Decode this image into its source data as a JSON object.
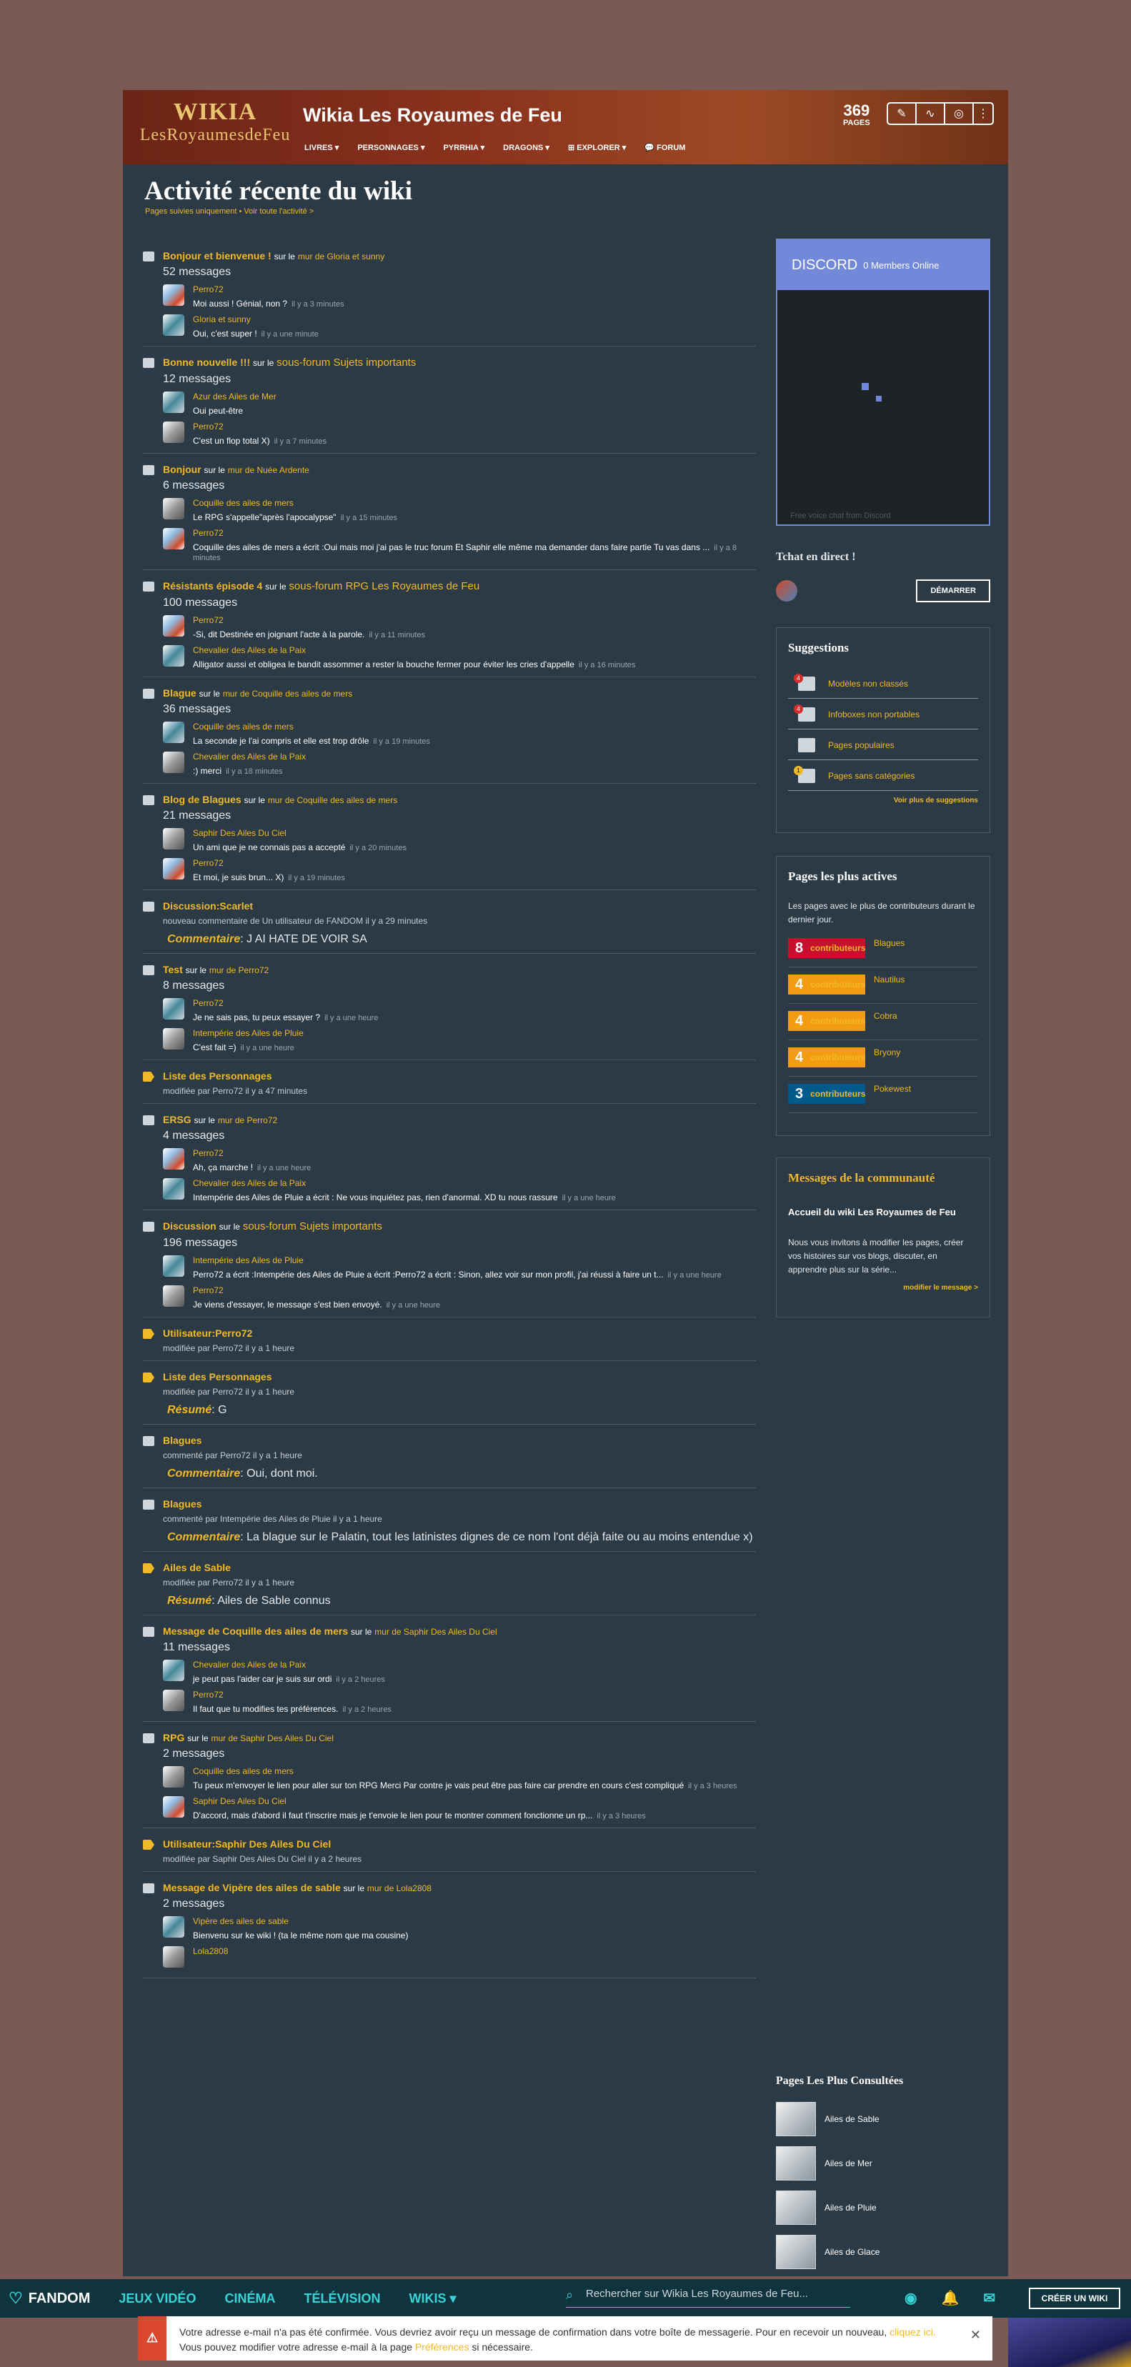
{
  "header": {
    "logo_top": "WIKIA",
    "logo_bottom": "LesRoyaumesdeFeu",
    "title": "Wikia Les Royaumes de Feu",
    "pages_count": "369",
    "pages_label": "PAGES",
    "nav": [
      "LIVRES ▾",
      "PERSONNAGES ▾",
      "PYRRHIA ▾",
      "DRAGONS ▾",
      "⊞ EXPLORER ▾",
      "💬 FORUM"
    ]
  },
  "page": {
    "title": "Activité récente du wiki",
    "subnav": "Pages suivies uniquement • Voir toute l'activité >"
  },
  "feed": [
    {
      "title": "Bonjour et bienvenue !",
      "on": "sur le",
      "where": "mur de Gloria et sunny",
      "count": "52 messages",
      "msgs": [
        {
          "user": "Perro72",
          "text": "Moi aussi ! Génial, non ?",
          "time": "il y a 3 minutes"
        },
        {
          "user": "Gloria et sunny",
          "text": "Oui, c'est super !",
          "time": "il y a une minute"
        }
      ]
    },
    {
      "title": "Bonne nouvelle !!!",
      "on": "sur le",
      "where": "sous-forum Sujets importants",
      "count": "12 messages",
      "msgs": [
        {
          "user": "Azur des Ailes de Mer",
          "text": "Oui peut-être",
          "time": ""
        },
        {
          "user": "Perro72",
          "text": "C'est un flop total X)",
          "time": "il y a 7 minutes"
        }
      ]
    },
    {
      "title": "Bonjour",
      "on": "sur le",
      "where": "mur de Nuée Ardente",
      "count": "6 messages",
      "msgs": [
        {
          "user": "Coquille des ailes de mers",
          "text": "Le RPG s'appelle\"après l'apocalypse\"",
          "time": "il y a 15 minutes"
        },
        {
          "user": "Perro72",
          "text": "Coquille des ailes de mers a écrit :Oui mais moi j'ai pas le truc forum Et Saphir elle même ma demander dans faire partie Tu vas dans ...",
          "time": "il y a 8 minutes"
        }
      ]
    },
    {
      "title": "Résistants épisode 4",
      "on": "sur le",
      "where": "sous-forum RPG Les Royaumes de Feu",
      "count": "100 messages",
      "msgs": [
        {
          "user": "Perro72",
          "text": "-Si, dit Destinée en joignant l'acte à la parole.",
          "time": "il y a 11 minutes"
        },
        {
          "user": "Chevalier des Ailes de la Paix",
          "text": "Alligator aussi et obligea le bandit assommer a rester la bouche fermer pour éviter les cries d'appelle",
          "time": "il y a 16 minutes"
        }
      ]
    },
    {
      "title": "Blague",
      "on": "sur le",
      "where": "mur de Coquille des ailes de mers",
      "count": "36 messages",
      "msgs": [
        {
          "user": "Coquille des ailes de mers",
          "text": "La seconde je l'ai compris et elle est trop drôle",
          "time": "il y a 19 minutes"
        },
        {
          "user": "Chevalier des Ailes de la Paix",
          "text": ":) merci",
          "time": "il y a 18 minutes"
        }
      ]
    },
    {
      "title": "Blog de Blagues",
      "on": "sur le",
      "where": "mur de Coquille des ailes de mers",
      "count": "21 messages",
      "msgs": [
        {
          "user": "Saphir Des Ailes Du Ciel",
          "text": "Un ami que je ne connais pas a accepté",
          "time": "il y a 20 minutes"
        },
        {
          "user": "Perro72",
          "text": "Et moi, je suis brun... X)",
          "time": "il y a 19 minutes"
        }
      ]
    },
    {
      "title": "Discussion:Scarlet",
      "meta": "nouveau commentaire de Un utilisateur de FANDOM il y a 29 minutes",
      "comment_label": "Commentaire",
      "comment": ": J AI HATE DE VOIR SA"
    },
    {
      "title": "Test",
      "on": "sur le",
      "where": "mur de Perro72",
      "count": "8 messages",
      "msgs": [
        {
          "user": "Perro72",
          "text": "Je ne sais pas, tu peux essayer ?",
          "time": "il y a une heure"
        },
        {
          "user": "Intempérie des Ailes de Pluie",
          "text": "C'est fait =)",
          "time": "il y a une heure"
        }
      ]
    },
    {
      "title": "Liste des Personnages",
      "edit": true,
      "meta": "modifiée par Perro72 il y a 47 minutes"
    },
    {
      "title": "ERSG",
      "on": "sur le",
      "where": "mur de Perro72",
      "count": "4 messages",
      "msgs": [
        {
          "user": "Perro72",
          "text": "Ah, ça marche !",
          "time": "il y a une heure"
        },
        {
          "user": "Chevalier des Ailes de la Paix",
          "text": "Intempérie des Ailes de Pluie a écrit : Ne vous inquiétez pas, rien d'anormal. XD tu nous rassure",
          "time": "il y a une heure"
        }
      ]
    },
    {
      "title": "Discussion",
      "on": "sur le",
      "where": "sous-forum Sujets importants",
      "count": "196 messages",
      "msgs": [
        {
          "user": "Intempérie des Ailes de Pluie",
          "text": "Perro72 a écrit :Intempérie des Ailes de Pluie a écrit :Perro72 a écrit : Sinon, allez voir sur mon profil, j'ai réussi à faire un t...",
          "time": "il y a une heure"
        },
        {
          "user": "Perro72",
          "text": "Je viens d'essayer, le message s'est bien envoyé.",
          "time": "il y a une heure"
        }
      ]
    },
    {
      "title": "Utilisateur:Perro72",
      "edit": true,
      "meta": "modifiée par Perro72 il y a 1 heure"
    },
    {
      "title": "Liste des Personnages",
      "edit": true,
      "meta": "modifiée par Perro72 il y a 1 heure",
      "comment_label": "Résumé",
      "comment": ": G"
    },
    {
      "title": "Blagues",
      "meta": "commenté par Perro72 il y a 1 heure",
      "comment_label": "Commentaire",
      "comment": ": Oui, dont moi."
    },
    {
      "title": "Blagues",
      "meta": "commenté par Intempérie des Ailes de Pluie il y a 1 heure",
      "comment_label": "Commentaire",
      "comment": ": La blague sur le Palatin, tout les latinistes dignes de ce nom l'ont déjà faite ou au moins entendue x)"
    },
    {
      "title": "Ailes de Sable",
      "edit": true,
      "meta": "modifiée par Perro72 il y a 1 heure",
      "comment_label": "Résumé",
      "comment": ": Ailes de Sable connus"
    },
    {
      "title": "Message de Coquille des ailes de mers",
      "on": "sur le",
      "where": "mur de Saphir Des Ailes Du Ciel",
      "count": "11 messages",
      "msgs": [
        {
          "user": "Chevalier des Ailes de la Paix",
          "text": "je peut pas l'aider car je suis sur ordi",
          "time": "il y a 2 heures"
        },
        {
          "user": "Perro72",
          "text": "Il faut que tu modifies tes préférences.",
          "time": "il y a 2 heures"
        }
      ]
    },
    {
      "title": "RPG",
      "on": "sur le",
      "where": "mur de Saphir Des Ailes Du Ciel",
      "count": "2 messages",
      "msgs": [
        {
          "user": "Coquille des ailes de mers",
          "text": "Tu peux m'envoyer le lien pour aller sur ton RPG Merci Par contre je vais peut être pas faire car prendre en cours c'est compliqué",
          "time": "il y a 3 heures"
        },
        {
          "user": "Saphir Des Ailes Du Ciel",
          "text": "D'accord, mais d'abord il faut t'inscrire mais je t'envoie le lien pour te montrer comment fonctionne un rp...",
          "time": "il y a 3 heures"
        }
      ]
    },
    {
      "title": "Utilisateur:Saphir Des Ailes Du Ciel",
      "edit": true,
      "meta": "modifiée par Saphir Des Ailes Du Ciel il y a 2 heures"
    },
    {
      "title": "Message de Vipère des ailes de sable",
      "on": "sur le",
      "where": "mur de Lola2808",
      "count": "2 messages",
      "msgs": [
        {
          "user": "Vipère des ailes de sable",
          "text": "Bienvenu sur ke wiki ! (ta le même nom que ma cousine)",
          "time": ""
        },
        {
          "user": "Lola2808",
          "text": "",
          "time": ""
        }
      ]
    }
  ],
  "discord": {
    "title": "DISCORD",
    "members": "0 Members Online",
    "footer": "Free voice chat from Discord"
  },
  "tchat": {
    "title": "Tchat en direct !",
    "button": "DÉMARRER"
  },
  "suggestions": {
    "title": "Suggestions",
    "items": [
      {
        "badge": "4",
        "label": "Modèles non classés"
      },
      {
        "badge": "4",
        "label": "Infoboxes non portables"
      },
      {
        "badge": "",
        "label": "Pages populaires"
      },
      {
        "badge": "1",
        "label": "Pages sans catégories"
      }
    ],
    "more": "Voir plus de suggestions"
  },
  "active": {
    "title": "Pages les plus actives",
    "desc": "Les pages avec le plus de contributeurs durant le dernier jour.",
    "unit": "contributeurs",
    "items": [
      {
        "n": "8",
        "page": "Blagues"
      },
      {
        "n": "4",
        "page": "Nautilus"
      },
      {
        "n": "4",
        "page": "Cobra"
      },
      {
        "n": "4",
        "page": "Bryony"
      },
      {
        "n": "3",
        "page": "Pokewest"
      }
    ]
  },
  "community": {
    "title": "Messages de la communauté",
    "heading": "Accueil du wiki Les Royaumes de Feu",
    "text": "Nous vous invitons à modifier les pages, créer vos histoires sur vos blogs, discuter, en apprendre plus sur la série...",
    "more": "modifier le message >"
  },
  "popular": {
    "title": "Pages Les Plus Consultées",
    "items": [
      "Ailes de Sable",
      "Ailes de Mer",
      "Ailes de Pluie",
      "Ailes de Glace"
    ]
  },
  "globalnav": {
    "brand": "FANDOM",
    "items": [
      "JEUX VIDÉO",
      "CINÉMA",
      "TÉLÉVISION",
      "WIKIS ▾"
    ],
    "search_placeholder": "Rechercher sur Wikia Les Royaumes de Feu...",
    "create": "CRÉER UN WIKI"
  },
  "notice": {
    "line1": "Votre adresse e-mail n'a pas été confirmée. Vous devriez avoir reçu un message de confirmation dans votre boîte de messagerie. Pour en recevoir un nouveau, ",
    "link1": "cliquez ici.",
    "line2": "Vous pouvez modifier votre adresse e-mail à la page ",
    "link2": "Préférences",
    "line3": " si nécessaire."
  }
}
